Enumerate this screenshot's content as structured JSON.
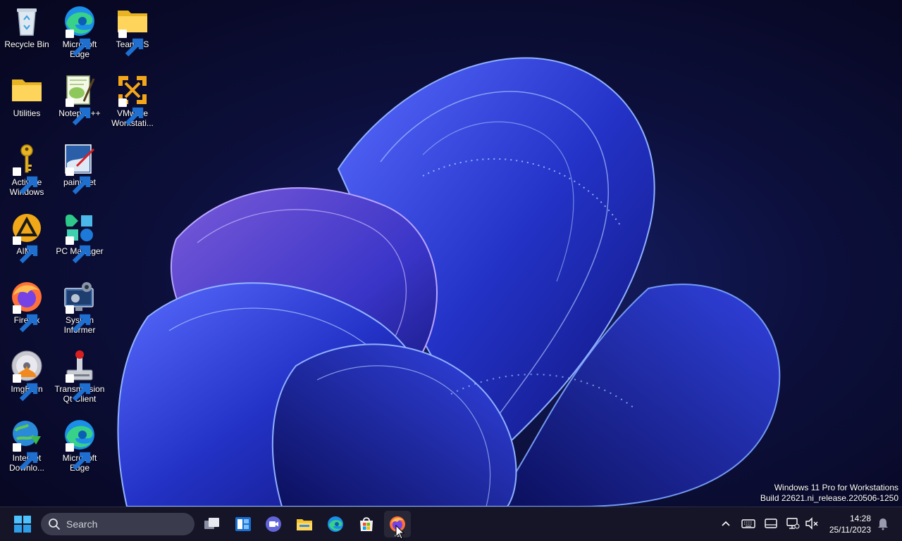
{
  "desktop": {
    "icons": [
      {
        "label": "Recycle Bin",
        "icon": "recycle-bin-icon"
      },
      {
        "label": "Microsoft Edge",
        "icon": "edge-icon"
      },
      {
        "label": "TeamOS",
        "icon": "folder-icon"
      },
      {
        "label": "Utilities",
        "icon": "folder-icon"
      },
      {
        "label": "Notepad++",
        "icon": "notepad-plus-plus-icon"
      },
      {
        "label": "VMware Workstati...",
        "icon": "vmware-icon"
      },
      {
        "label": "Activate Windows",
        "icon": "key-icon"
      },
      {
        "label": "paint.net",
        "icon": "paint-net-icon"
      },
      {
        "label": "AIMP",
        "icon": "aimp-icon"
      },
      {
        "label": "PC Manager",
        "icon": "pc-manager-icon"
      },
      {
        "label": "Firefox",
        "icon": "firefox-icon"
      },
      {
        "label": "System Informer",
        "icon": "system-informer-icon"
      },
      {
        "label": "ImgBurn",
        "icon": "imgburn-icon"
      },
      {
        "label": "Transmission Qt Client",
        "icon": "transmission-icon"
      },
      {
        "label": "Internet Downlo...",
        "icon": "internet-download-manager-icon"
      },
      {
        "label": "Microsoft Edge",
        "icon": "edge-icon"
      }
    ]
  },
  "watermark": {
    "line1": "Windows 11 Pro for Workstations",
    "line2": "Build 22621.ni_release.220506-1250"
  },
  "taskbar": {
    "search_placeholder": "Search",
    "pinned": [
      "start-icon",
      "task-view-icon",
      "widgets-icon",
      "teams-meet-icon",
      "file-explorer-icon",
      "edge-icon",
      "microsoft-store-icon",
      "firefox-icon"
    ],
    "clock": {
      "time": "14:28",
      "date": "25/11/2023"
    }
  },
  "colors": {
    "wallpaper_bg": "#0b0a2e",
    "bloom": "#2a3bd8",
    "taskbar": "#16162a"
  }
}
